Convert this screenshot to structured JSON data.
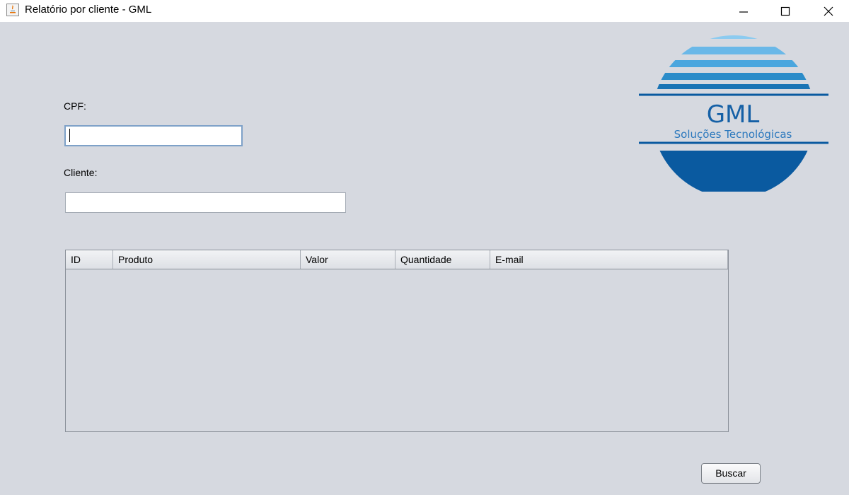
{
  "window": {
    "title": "Relatório por cliente - GML",
    "controls": [
      "minimize",
      "maximize",
      "close"
    ]
  },
  "form": {
    "cpf_label": "CPF:",
    "cpf_value": "",
    "cliente_label": "Cliente:",
    "cliente_value": ""
  },
  "table": {
    "columns": [
      "ID",
      "Produto",
      "Valor",
      "Quantidade",
      "E-mail"
    ],
    "rows": []
  },
  "actions": {
    "buscar_label": "Buscar"
  },
  "logo": {
    "name": "GML",
    "tagline": "Soluções Tecnológicas",
    "colors": {
      "light": "#6ab8e8",
      "mid": "#2b8cc9",
      "dark": "#0a5aa0"
    }
  }
}
